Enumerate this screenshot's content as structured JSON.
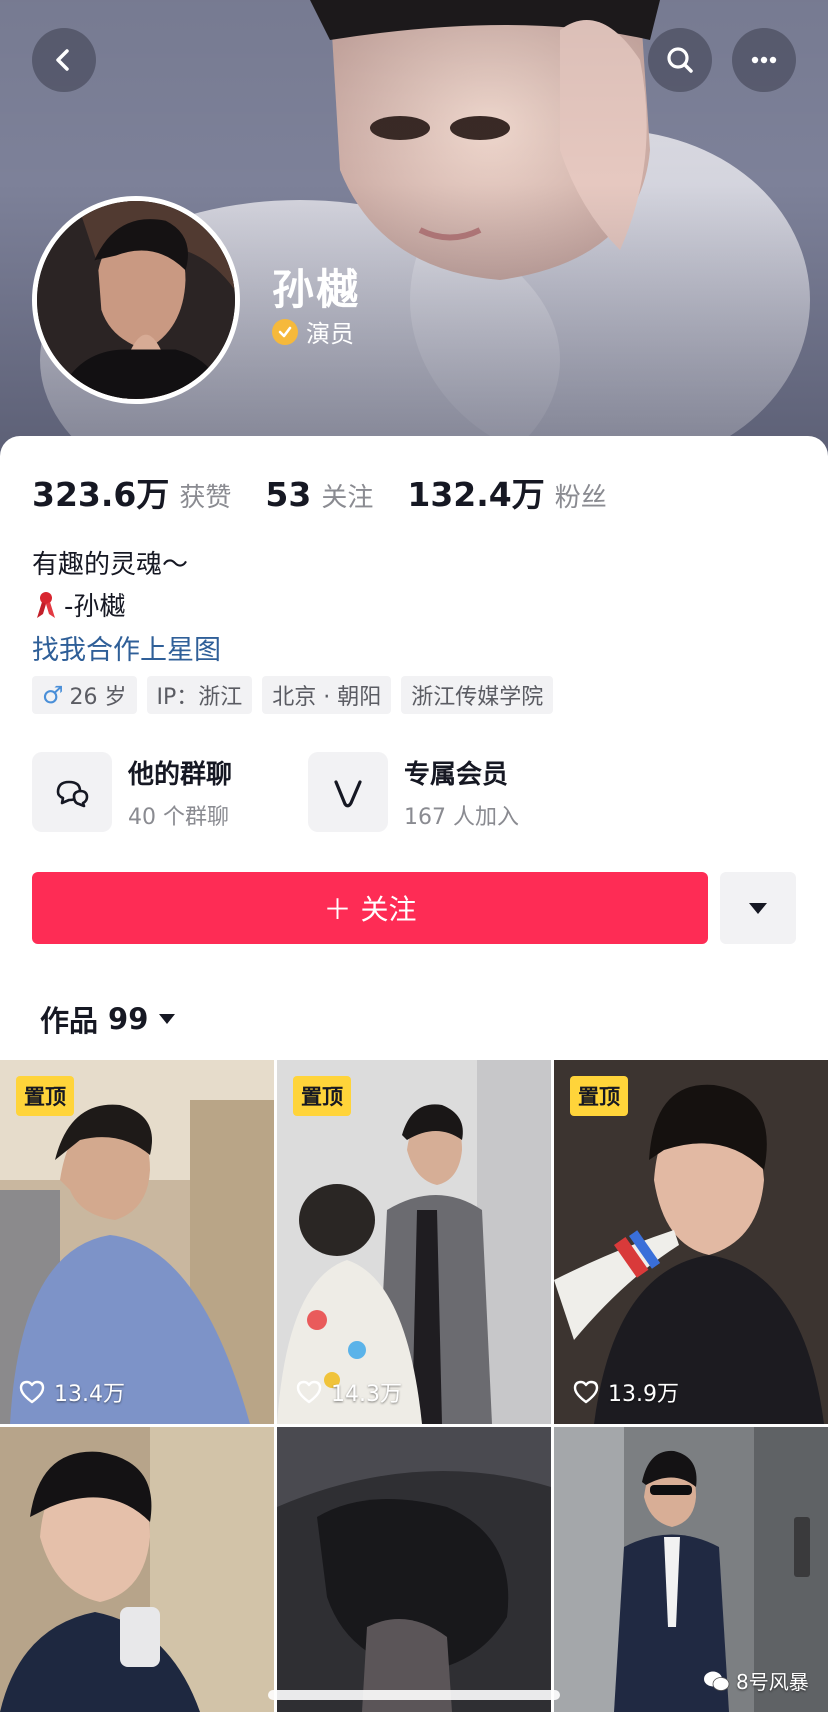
{
  "header": {
    "back_icon": "back-chevron-icon",
    "search_icon": "search-icon",
    "more_icon": "more-dots-icon"
  },
  "profile": {
    "name": "孙樾",
    "verified_label": "演员",
    "verified_color": "#f6b93b"
  },
  "stats": [
    {
      "value": "323.6万",
      "label": "获赞"
    },
    {
      "value": "53",
      "label": "关注"
    },
    {
      "value": "132.4万",
      "label": "粉丝"
    }
  ],
  "bio": {
    "line1": "有趣的灵魂～",
    "line2": "-孙樾",
    "link": "找我合作上星图"
  },
  "tags": {
    "age": "26 岁",
    "ip": "IP：浙江",
    "location": "北京 · 朝阳",
    "school": "浙江传媒学院"
  },
  "features": [
    {
      "title": "他的群聊",
      "sub": "40 个群聊",
      "icon": "chat-bubbles-icon"
    },
    {
      "title": "专属会员",
      "sub": "167 人加入",
      "icon": "member-v-icon"
    }
  ],
  "actions": {
    "follow_label": "＋ 关注",
    "follow_color": "#fe2c55"
  },
  "works": {
    "label": "作品",
    "count": "99"
  },
  "grid": [
    {
      "pinned": "置顶",
      "likes": "13.4万"
    },
    {
      "pinned": "置顶",
      "likes": "14.3万"
    },
    {
      "pinned": "置顶",
      "likes": "13.9万"
    },
    {
      "pinned": "",
      "likes": ""
    },
    {
      "pinned": "",
      "likes": ""
    },
    {
      "pinned": "",
      "likes": ""
    }
  ],
  "watermark": "8号风暴"
}
